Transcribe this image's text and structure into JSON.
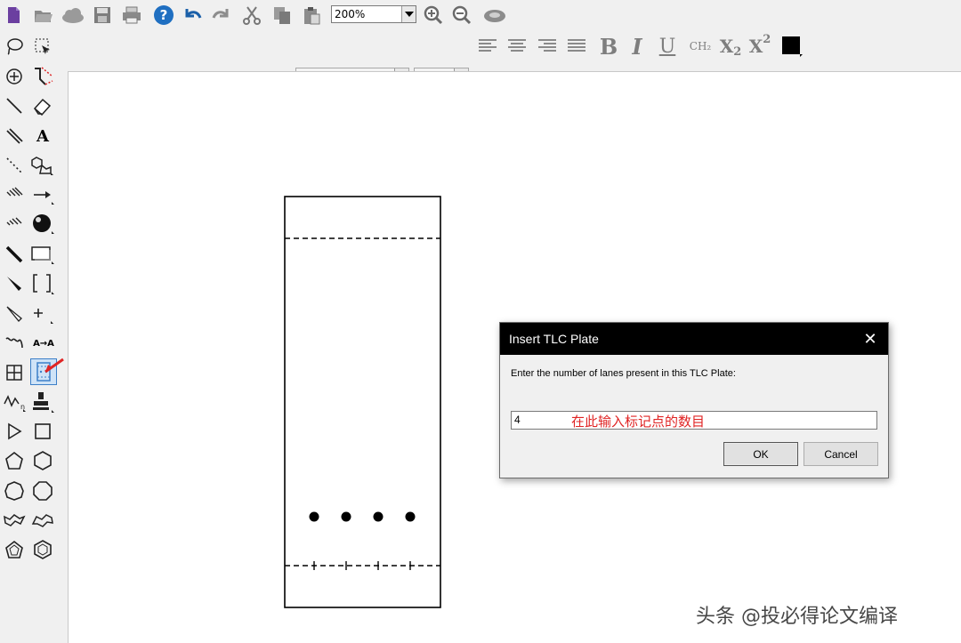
{
  "toolbar": {
    "zoom_value": "200%",
    "format_labels": {
      "bold": "B",
      "italic": "I",
      "underline": "U",
      "formula": "CH₂",
      "subscript_base": "X",
      "subscript": "2",
      "superscript_base": "X",
      "superscript": "2"
    }
  },
  "palette": {
    "text_tool_label": "A",
    "mapping_tool_label": "A→A"
  },
  "tlc_plate": {
    "spot_count": 4
  },
  "dialog": {
    "title": "Insert TLC Plate",
    "close_label": "✕",
    "prompt": "Enter the number of lanes present in this TLC Plate:",
    "lanes_value": "4",
    "annotation": "在此输入标记点的数目",
    "ok_label": "OK",
    "cancel_label": "Cancel"
  },
  "watermark": "头条 @投必得论文编译",
  "colors": {
    "annotation": "#e02424",
    "titlebar": "#000000",
    "canvas": "#ffffff"
  }
}
